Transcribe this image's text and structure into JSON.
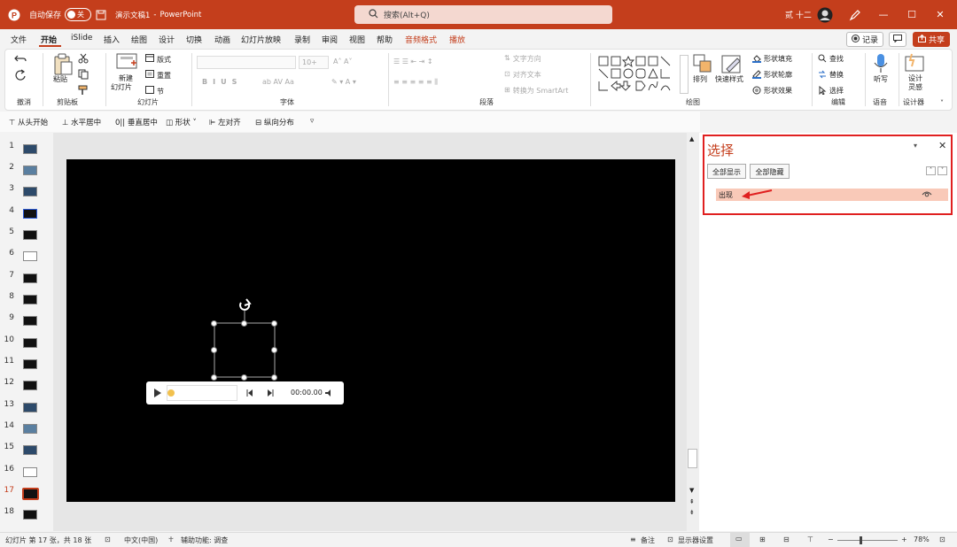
{
  "titlebar": {
    "autosave_label": "自动保存",
    "autosave_state": "关",
    "doc_title": "演示文稿1",
    "separator": "-",
    "app_name": "PowerPoint",
    "search_placeholder": "搜索(Alt+Q)",
    "user_name": "贰 十二"
  },
  "menu": {
    "items": [
      "文件",
      "开始",
      "iSlide",
      "插入",
      "绘图",
      "设计",
      "切换",
      "动画",
      "幻灯片放映",
      "录制",
      "审阅",
      "视图",
      "帮助",
      "音频格式",
      "播放"
    ],
    "record_label": "记录",
    "share_label": "共享"
  },
  "ribbon": {
    "undo_group": "撤消",
    "clipboard": {
      "paste": "粘贴",
      "group": "剪贴板"
    },
    "slides": {
      "new_slide": "新建",
      "new_slide2": "幻灯片",
      "layout": "版式",
      "reset": "重置",
      "section": "节",
      "group": "幻灯片"
    },
    "font": {
      "size": "10+",
      "group": "字体"
    },
    "paragraph": {
      "text_direction": "文字方向",
      "align_text": "对齐文本",
      "smartart": "转换为 SmartArt",
      "group": "段落"
    },
    "drawing": {
      "arrange": "排列",
      "quick_styles": "快速样式",
      "fill": "形状填充",
      "outline": "形状轮廓",
      "effects": "形状效果",
      "group": "绘图"
    },
    "editing": {
      "find": "查找",
      "replace": "替换",
      "select": "选择",
      "group": "编辑"
    },
    "voice": {
      "dictate": "听写",
      "group": "语音"
    },
    "designer": {
      "label1": "设计",
      "label2": "灵感",
      "group": "设计器"
    }
  },
  "quick_access": [
    "从头开始",
    "水平居中",
    "垂直居中",
    "形状",
    "左对齐",
    "纵向分布"
  ],
  "thumbnails": [
    "1",
    "2",
    "3",
    "4",
    "5",
    "6",
    "7",
    "8",
    "9",
    "10",
    "11",
    "12",
    "13",
    "14",
    "15",
    "16",
    "17",
    "18"
  ],
  "current_slide": "17",
  "media_player": {
    "time": "00:00.00"
  },
  "selection_pane": {
    "title": "选择",
    "show_all": "全部显示",
    "hide_all": "全部隐藏",
    "item": "出现"
  },
  "status": {
    "slide_info": "幻灯片 第 17 张，共 18 张",
    "language": "中文(中国)",
    "accessibility": "辅助功能: 调查",
    "notes": "备注",
    "display_settings": "显示器设置",
    "zoom": "78%"
  },
  "colors": {
    "accent": "#c43e1c",
    "annotation": "#e02020",
    "selected_item": "#f9c9b8"
  }
}
